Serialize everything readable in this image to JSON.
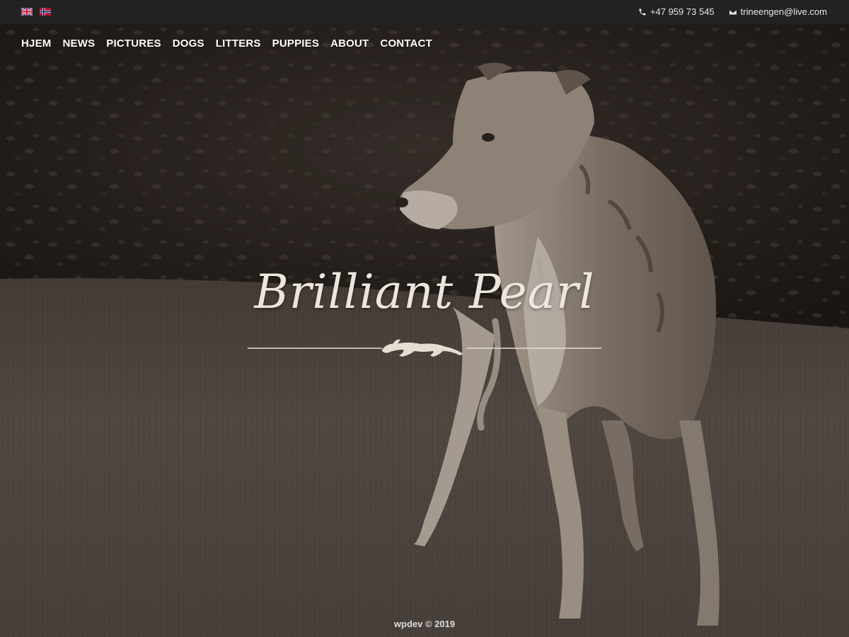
{
  "topbar": {
    "languages": [
      {
        "name": "english-flag",
        "label": "EN"
      },
      {
        "name": "norwegian-flag",
        "label": "NO"
      }
    ],
    "phone": "+47 959 73 545",
    "email": "trineengen@live.com"
  },
  "nav": {
    "items": [
      "HJEM",
      "NEWS",
      "PICTURES",
      "DOGS",
      "LITTERS",
      "PUPPIES",
      "ABOUT",
      "CONTACT"
    ]
  },
  "hero": {
    "title": "Brilliant Pearl",
    "emblem_icon": "running-greyhound-icon"
  },
  "footer": {
    "text": "wpdev © 2019"
  },
  "colors": {
    "topbar_bg": "#222222",
    "text_light": "#ece6de",
    "grass": "#5a504a",
    "foliage": "#2a2320"
  }
}
